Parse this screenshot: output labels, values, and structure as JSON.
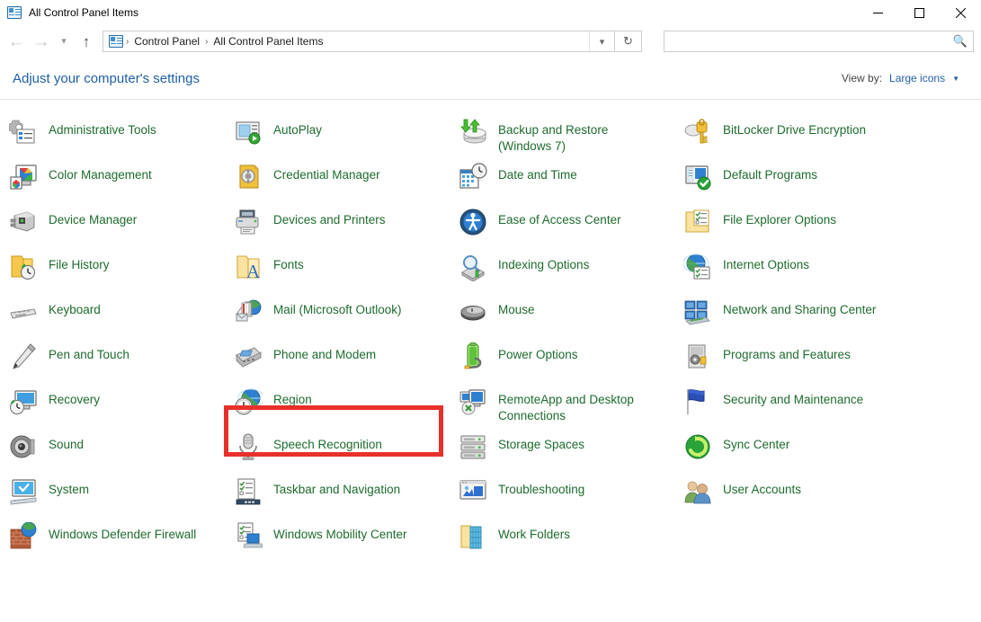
{
  "window": {
    "title": "All Control Panel Items",
    "icon": "control-panel-icon",
    "controls": {
      "minimize": "minimize-icon",
      "maximize": "maximize-icon",
      "close": "close-icon"
    }
  },
  "navigation": {
    "back": "back-arrow-icon",
    "forward": "forward-arrow-icon",
    "recent": "chevron-down-icon",
    "up": "up-arrow-icon",
    "refresh": "refresh-icon",
    "address_dropdown": "chevron-down-icon",
    "breadcrumbs": [
      "Control Panel",
      "All Control Panel Items"
    ],
    "separator": "›"
  },
  "search": {
    "value": "",
    "placeholder": "",
    "icon": "search-icon"
  },
  "header": {
    "title": "Adjust your computer's settings",
    "view_by_label": "View by:",
    "view_by_value": "Large icons",
    "view_by_caret": "▼"
  },
  "colors": {
    "item_label": "#1d6b2e",
    "link": "#1f5fa8",
    "highlight": "#e8302a"
  },
  "annotation": {
    "type": "red-rectangle-highlight",
    "target": "Mail (Microsoft Outlook)",
    "color": "#e8302a"
  },
  "items": [
    {
      "label": "Administrative Tools",
      "icon": "administrative-tools-icon",
      "col": 1,
      "row": 1
    },
    {
      "label": "AutoPlay",
      "icon": "autoplay-icon",
      "col": 2,
      "row": 1
    },
    {
      "label": "Backup and Restore (Windows 7)",
      "icon": "backup-restore-icon",
      "col": 3,
      "row": 1
    },
    {
      "label": "BitLocker Drive Encryption",
      "icon": "bitlocker-icon",
      "col": 4,
      "row": 1
    },
    {
      "label": "Color Management",
      "icon": "color-management-icon",
      "col": 1,
      "row": 2
    },
    {
      "label": "Credential Manager",
      "icon": "credential-manager-icon",
      "col": 2,
      "row": 2
    },
    {
      "label": "Date and Time",
      "icon": "date-time-icon",
      "col": 3,
      "row": 2
    },
    {
      "label": "Default Programs",
      "icon": "default-programs-icon",
      "col": 4,
      "row": 2
    },
    {
      "label": "Device Manager",
      "icon": "device-manager-icon",
      "col": 1,
      "row": 3
    },
    {
      "label": "Devices and Printers",
      "icon": "devices-printers-icon",
      "col": 2,
      "row": 3
    },
    {
      "label": "Ease of Access Center",
      "icon": "ease-of-access-icon",
      "col": 3,
      "row": 3
    },
    {
      "label": "File Explorer Options",
      "icon": "file-explorer-options-icon",
      "col": 4,
      "row": 3
    },
    {
      "label": "File History",
      "icon": "file-history-icon",
      "col": 1,
      "row": 4
    },
    {
      "label": "Fonts",
      "icon": "fonts-icon",
      "col": 2,
      "row": 4
    },
    {
      "label": "Indexing Options",
      "icon": "indexing-options-icon",
      "col": 3,
      "row": 4
    },
    {
      "label": "Internet Options",
      "icon": "internet-options-icon",
      "col": 4,
      "row": 4
    },
    {
      "label": "Keyboard",
      "icon": "keyboard-icon",
      "col": 1,
      "row": 5
    },
    {
      "label": "Mail (Microsoft Outlook)",
      "icon": "mail-outlook-icon",
      "col": 2,
      "row": 5,
      "highlighted": true
    },
    {
      "label": "Mouse",
      "icon": "mouse-icon",
      "col": 3,
      "row": 5
    },
    {
      "label": "Network and Sharing Center",
      "icon": "network-sharing-icon",
      "col": 4,
      "row": 5
    },
    {
      "label": "Pen and Touch",
      "icon": "pen-touch-icon",
      "col": 1,
      "row": 6
    },
    {
      "label": "Phone and Modem",
      "icon": "phone-modem-icon",
      "col": 2,
      "row": 6
    },
    {
      "label": "Power Options",
      "icon": "power-options-icon",
      "col": 3,
      "row": 6
    },
    {
      "label": "Programs and Features",
      "icon": "programs-features-icon",
      "col": 4,
      "row": 6
    },
    {
      "label": "Recovery",
      "icon": "recovery-icon",
      "col": 1,
      "row": 7
    },
    {
      "label": "Region",
      "icon": "region-icon",
      "col": 2,
      "row": 7
    },
    {
      "label": "RemoteApp and Desktop Connections",
      "icon": "remoteapp-icon",
      "col": 3,
      "row": 7
    },
    {
      "label": "Security and Maintenance",
      "icon": "security-maintenance-icon",
      "col": 4,
      "row": 7
    },
    {
      "label": "Sound",
      "icon": "sound-icon",
      "col": 1,
      "row": 8
    },
    {
      "label": "Speech Recognition",
      "icon": "speech-recognition-icon",
      "col": 2,
      "row": 8
    },
    {
      "label": "Storage Spaces",
      "icon": "storage-spaces-icon",
      "col": 3,
      "row": 8
    },
    {
      "label": "Sync Center",
      "icon": "sync-center-icon",
      "col": 4,
      "row": 8
    },
    {
      "label": "System",
      "icon": "system-icon",
      "col": 1,
      "row": 9
    },
    {
      "label": "Taskbar and Navigation",
      "icon": "taskbar-navigation-icon",
      "col": 2,
      "row": 9
    },
    {
      "label": "Troubleshooting",
      "icon": "troubleshooting-icon",
      "col": 3,
      "row": 9
    },
    {
      "label": "User Accounts",
      "icon": "user-accounts-icon",
      "col": 4,
      "row": 9
    },
    {
      "label": "Windows Defender Firewall",
      "icon": "windows-defender-firewall-icon",
      "col": 1,
      "row": 10
    },
    {
      "label": "Windows Mobility Center",
      "icon": "windows-mobility-icon",
      "col": 2,
      "row": 10
    },
    {
      "label": "Work Folders",
      "icon": "work-folders-icon",
      "col": 3,
      "row": 10
    }
  ]
}
